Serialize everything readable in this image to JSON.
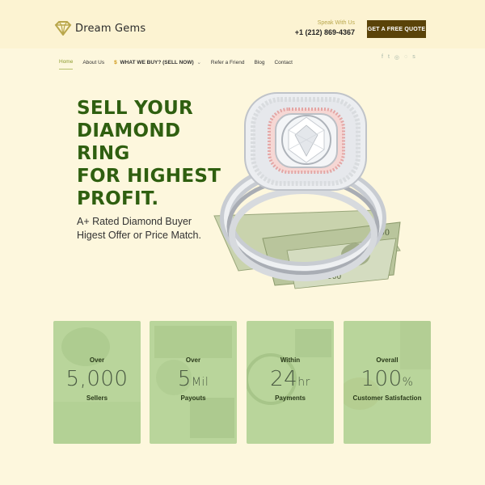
{
  "brand": {
    "name": "Dream Gems",
    "logo_icon": "diamond-logo-icon"
  },
  "contact": {
    "speak_label": "Speak With Us",
    "phone": "+1 (212) 869-4367"
  },
  "cta": {
    "quote_label": "GET A FREE QUOTE"
  },
  "nav": {
    "items": [
      {
        "label": "Home",
        "active": true
      },
      {
        "label": "About Us"
      },
      {
        "label": "WHAT WE BUY? (SELL NOW)",
        "prefix": "$",
        "dropdown": true
      },
      {
        "label": "Refer a Friend"
      },
      {
        "label": "Blog"
      },
      {
        "label": "Contact"
      }
    ],
    "social": [
      "facebook-icon",
      "twitter-icon",
      "instagram-icon",
      "whatsapp-icon",
      "skype-icon"
    ]
  },
  "hero": {
    "headline_1": "SELL YOUR",
    "headline_2": "DIAMOND RING",
    "headline_3": "FOR HIGHEST",
    "headline_4": "PROFIT.",
    "sub_1": "A+ Rated Diamond Buyer",
    "sub_2": "Higest Offer or Price Match.",
    "image": "diamond-ring-on-dollar-bills"
  },
  "stats": [
    {
      "pre": "Over",
      "value": "5,000",
      "suffix": "",
      "post": "Sellers"
    },
    {
      "pre": "Over",
      "value": "5",
      "suffix": "Mil",
      "post": "Payouts"
    },
    {
      "pre": "Within",
      "value": "24",
      "suffix": "hr",
      "post": "Payments"
    },
    {
      "pre": "Overall",
      "value": "100",
      "suffix": "%",
      "post": "Customer Satisfaction"
    }
  ],
  "colors": {
    "background": "#fdf7dd",
    "headline": "#2f5f10",
    "button": "#5a4309",
    "card": "#b9d59b",
    "nav_active": "#8a9a2c"
  }
}
